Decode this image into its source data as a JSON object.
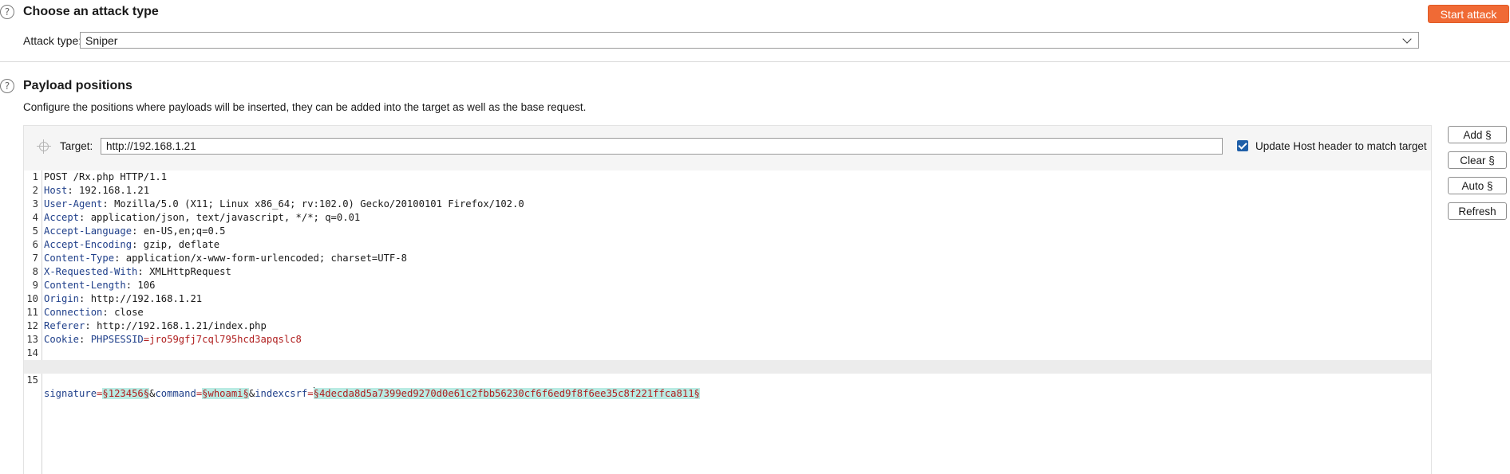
{
  "attack": {
    "title": "Choose an attack type",
    "start_button": "Start attack",
    "type_label": "Attack type:",
    "type_value": "Sniper"
  },
  "positions": {
    "title": "Payload positions",
    "description": "Configure the positions where payloads will be inserted, they can be added into the target as well as the base request.",
    "target_label": "Target:",
    "target_value": "http://192.168.1.21",
    "update_host_label": "Update Host header to match target",
    "update_host_checked": true,
    "buttons": {
      "add": "Add §",
      "clear": "Clear §",
      "auto": "Auto §",
      "refresh": "Refresh"
    }
  },
  "request": {
    "lines": [
      {
        "n": "1",
        "name": "",
        "value": "POST /Rx.php HTTP/1.1"
      },
      {
        "n": "2",
        "name": "Host",
        "value": "192.168.1.21"
      },
      {
        "n": "3",
        "name": "User-Agent",
        "value": "Mozilla/5.0 (X11; Linux x86_64; rv:102.0) Gecko/20100101 Firefox/102.0"
      },
      {
        "n": "4",
        "name": "Accept",
        "value": "application/json, text/javascript, */*; q=0.01"
      },
      {
        "n": "5",
        "name": "Accept-Language",
        "value": "en-US,en;q=0.5"
      },
      {
        "n": "6",
        "name": "Accept-Encoding",
        "value": "gzip, deflate"
      },
      {
        "n": "7",
        "name": "Content-Type",
        "value": "application/x-www-form-urlencoded; charset=UTF-8"
      },
      {
        "n": "8",
        "name": "X-Requested-With",
        "value": "XMLHttpRequest"
      },
      {
        "n": "9",
        "name": "Content-Length",
        "value": "106"
      },
      {
        "n": "10",
        "name": "Origin",
        "value": "http://192.168.1.21"
      },
      {
        "n": "11",
        "name": "Connection",
        "value": "close"
      },
      {
        "n": "12",
        "name": "Referer",
        "value": "http://192.168.1.21/index.php"
      },
      {
        "n": "13",
        "name": "Cookie",
        "value": ""
      },
      {
        "n": "14",
        "name": "",
        "value": ""
      }
    ],
    "cookie": {
      "name": "PHPSESSID",
      "eq": "=",
      "value": "jro59gfj7cql795hcd3apqslc8"
    },
    "body": {
      "n": "15",
      "p1_name": "signature",
      "p1_eq": "=",
      "p1_value": "§123456§",
      "amp1": "&",
      "p2_name": "command",
      "p2_eq": "=",
      "p2_value": "§whoami§",
      "amp2": "&",
      "p3_name": "indexcsrf",
      "p3_eq": "=",
      "p3_mark_open": "§",
      "p3_value": "4decda8d5a7399ed9270d0e61c2fbb56230cf6f6ed9f8f6ee35c8f221ffca811§"
    }
  },
  "colors": {
    "accent": "#f06a35",
    "header_name": "#1f3f8a",
    "param_value": "#b02020",
    "payload_marker_bg": "#b9ebe3",
    "checkbox": "#1f5fa8"
  },
  "icons": [
    "help-icon",
    "crosshair-icon",
    "chevron-down-icon",
    "checkbox-checked-icon"
  ]
}
